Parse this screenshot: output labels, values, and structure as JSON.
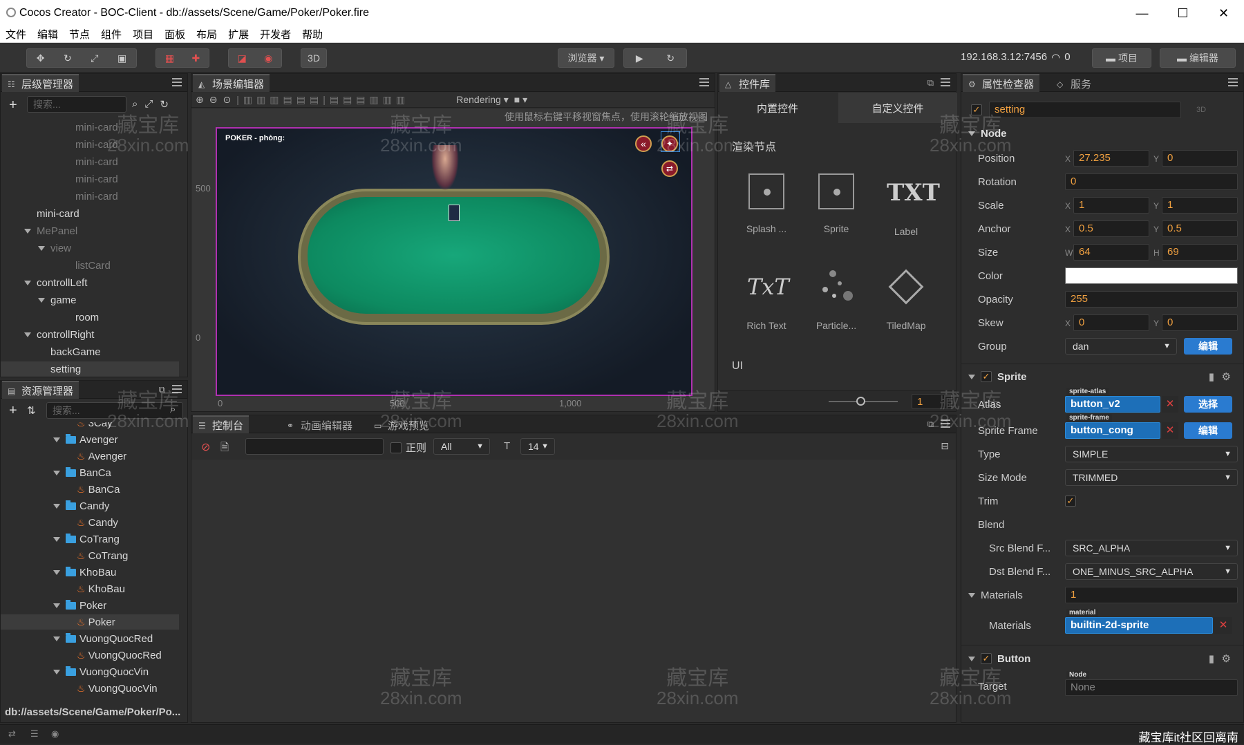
{
  "window": {
    "title": "Cocos Creator - BOC-Client - db://assets/Scene/Game/Poker/Poker.fire",
    "minimize": "—",
    "maximize": "☐",
    "close": "✕"
  },
  "menu": [
    "文件",
    "编辑",
    "节点",
    "组件",
    "项目",
    "面板",
    "布局",
    "扩展",
    "开发者",
    "帮助"
  ],
  "toolbar": {
    "mode3d": "3D",
    "browser": "浏览器",
    "ip": "192.168.3.12:7456",
    "conn_count": "0",
    "project": "项目",
    "editor": "编辑器"
  },
  "hierarchy": {
    "tab": "层级管理器",
    "search_placeholder": "搜索...",
    "rows": [
      {
        "label": "mini-card",
        "dim": true,
        "depth": 3
      },
      {
        "label": "mini-card",
        "dim": true,
        "depth": 3
      },
      {
        "label": "mini-card",
        "dim": true,
        "depth": 3
      },
      {
        "label": "mini-card",
        "dim": true,
        "depth": 3
      },
      {
        "label": "mini-card",
        "dim": true,
        "depth": 3
      },
      {
        "label": "mini-card",
        "dim": false,
        "depth": 1
      },
      {
        "label": "MePanel",
        "dim": true,
        "depth": 1,
        "expand": true
      },
      {
        "label": "view",
        "dim": true,
        "depth": 2,
        "expand": true
      },
      {
        "label": "listCard",
        "dim": true,
        "depth": 3
      },
      {
        "label": "controllLeft",
        "dim": false,
        "depth": 1,
        "expand": true
      },
      {
        "label": "game",
        "dim": false,
        "depth": 2,
        "expand": true
      },
      {
        "label": "room",
        "dim": false,
        "depth": 3
      },
      {
        "label": "controllRight",
        "dim": false,
        "depth": 1,
        "expand": true
      },
      {
        "label": "backGame",
        "dim": false,
        "depth": 2
      },
      {
        "label": "setting",
        "dim": false,
        "depth": 2,
        "selected": true
      }
    ]
  },
  "assets": {
    "tab": "资源管理器",
    "search_placeholder": "搜索...",
    "path": "db://assets/Scene/Game/Poker/Po...",
    "rows": [
      {
        "label": "3Cay",
        "type": "fire",
        "depth": 2
      },
      {
        "label": "Avenger",
        "type": "folder",
        "depth": 1
      },
      {
        "label": "Avenger",
        "type": "fire",
        "depth": 2
      },
      {
        "label": "BanCa",
        "type": "folder",
        "depth": 1
      },
      {
        "label": "BanCa",
        "type": "fire",
        "depth": 2
      },
      {
        "label": "Candy",
        "type": "folder",
        "depth": 1
      },
      {
        "label": "Candy",
        "type": "fire",
        "depth": 2
      },
      {
        "label": "CoTrang",
        "type": "folder",
        "depth": 1
      },
      {
        "label": "CoTrang",
        "type": "fire",
        "depth": 2
      },
      {
        "label": "KhoBau",
        "type": "folder",
        "depth": 1
      },
      {
        "label": "KhoBau",
        "type": "fire",
        "depth": 2
      },
      {
        "label": "Poker",
        "type": "folder",
        "depth": 1
      },
      {
        "label": "Poker",
        "type": "fire",
        "depth": 2,
        "selected": true
      },
      {
        "label": "VuongQuocRed",
        "type": "folder",
        "depth": 1
      },
      {
        "label": "VuongQuocRed",
        "type": "fire",
        "depth": 2
      },
      {
        "label": "VuongQuocVin",
        "type": "folder",
        "depth": 1
      },
      {
        "label": "VuongQuocVin",
        "type": "fire",
        "depth": 2
      }
    ]
  },
  "scene": {
    "tab": "场景编辑器",
    "rendering": "Rendering",
    "hint": "使用鼠标右键平移视窗焦点，使用滚轮缩放视图",
    "game_title": "POKER - phòng:",
    "axis_y": [
      "500",
      "0"
    ],
    "axis_x": [
      "0",
      "500",
      "1,000"
    ],
    "zoom_value": "1"
  },
  "widgets": {
    "tab": "控件库",
    "tab_builtin": "内置控件",
    "tab_custom": "自定义控件",
    "section": "渲染节点",
    "section_ui": "UI",
    "items": [
      "Splash ...",
      "Sprite",
      "Label",
      "Rich Text",
      "Particle...",
      "TiledMap"
    ],
    "label_txt": "TXT",
    "rich_txt": "TxT"
  },
  "console": {
    "tabs": [
      "控制台",
      "动画编辑器",
      "游戏预览"
    ],
    "regex": "正则",
    "level": "All",
    "font_size": "14"
  },
  "inspector": {
    "tabs": [
      "属性检查器",
      "服务"
    ],
    "node_name": "setting",
    "mode3d": "3D",
    "node_section": "Node",
    "props": {
      "position": {
        "label": "Position",
        "x": "27.235",
        "y": "0"
      },
      "rotation": {
        "label": "Rotation",
        "value": "0"
      },
      "scale": {
        "label": "Scale",
        "x": "1",
        "y": "1"
      },
      "anchor": {
        "label": "Anchor",
        "x": "0.5",
        "y": "0.5"
      },
      "size": {
        "label": "Size",
        "w": "64",
        "h": "69"
      },
      "color": {
        "label": "Color",
        "value": "#ffffff"
      },
      "opacity": {
        "label": "Opacity",
        "value": "255"
      },
      "skew": {
        "label": "Skew",
        "x": "0",
        "y": "0"
      },
      "group": {
        "label": "Group",
        "value": "dan",
        "btn": "编辑"
      }
    },
    "axis": {
      "x": "X",
      "y": "Y",
      "w": "W",
      "h": "H"
    },
    "sprite_section": "Sprite",
    "sprite": {
      "atlas_label": "Atlas",
      "atlas_tag": "sprite-atlas",
      "atlas_value": "button_v2",
      "atlas_btn": "选择",
      "frame_label": "Sprite Frame",
      "frame_tag": "sprite-frame",
      "frame_value": "button_cong",
      "frame_btn": "编辑",
      "type_label": "Type",
      "type_value": "SIMPLE",
      "sizemode_label": "Size Mode",
      "sizemode_value": "TRIMMED",
      "trim_label": "Trim",
      "blend_label": "Blend",
      "src_label": "Src Blend F...",
      "src_value": "SRC_ALPHA",
      "dst_label": "Dst Blend F...",
      "dst_value": "ONE_MINUS_SRC_ALPHA",
      "materials_label": "Materials",
      "materials_count": "1",
      "material_label": "Materials",
      "material_tag": "material",
      "material_value": "builtin-2d-sprite"
    },
    "button_section": "Button",
    "button": {
      "target_label": "Target",
      "target_tag": "Node",
      "target_value": "None"
    }
  },
  "status": {
    "right_text": "藏宝库it社区回离南"
  },
  "watermark": {
    "cn": "藏宝库",
    "en": "28xin.com"
  }
}
